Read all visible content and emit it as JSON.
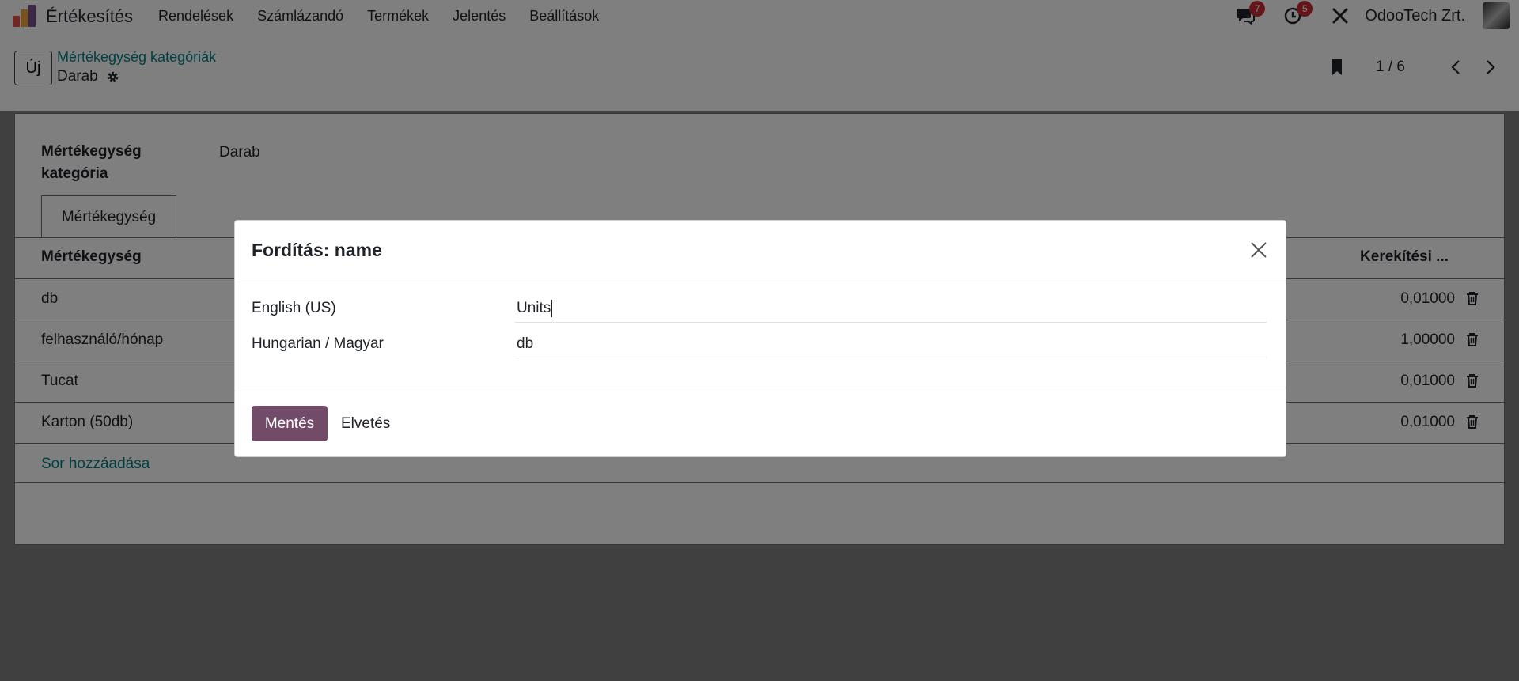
{
  "navbar": {
    "app_name": "Értékesítés",
    "menu": [
      "Rendelések",
      "Számlázandó",
      "Termékek",
      "Jelentés",
      "Beállítások"
    ],
    "messages_badge": "7",
    "activities_badge": "5",
    "company": "OdooTech Zrt."
  },
  "control_panel": {
    "new_label": "Új",
    "breadcrumb": "Mértékegység kategóriák",
    "record_name": "Darab",
    "pager": "1 / 6"
  },
  "form": {
    "category_label": "Mértékegység kategória",
    "category_value": "Darab",
    "tab_label": "Mértékegység",
    "columns": {
      "uom": "Mértékegység",
      "rounding": "Kerekítési ..."
    },
    "rows": [
      {
        "name": "db",
        "rounding": "0,01000"
      },
      {
        "name": "felhasználó/hónap",
        "rounding": "1,00000"
      },
      {
        "name": "Tucat",
        "rounding": "0,01000"
      },
      {
        "name": "Karton (50db)",
        "rounding": "0,01000"
      }
    ],
    "add_line": "Sor hozzáadása"
  },
  "dialog": {
    "title": "Fordítás: name",
    "translations": [
      {
        "lang": "English (US)",
        "value": "Units"
      },
      {
        "lang": "Hungarian / Magyar",
        "value": "db"
      }
    ],
    "save_label": "Mentés",
    "discard_label": "Elvetés"
  },
  "colors": {
    "primary": "#714b67",
    "link": "#017e84",
    "badge": "#c72a32"
  }
}
